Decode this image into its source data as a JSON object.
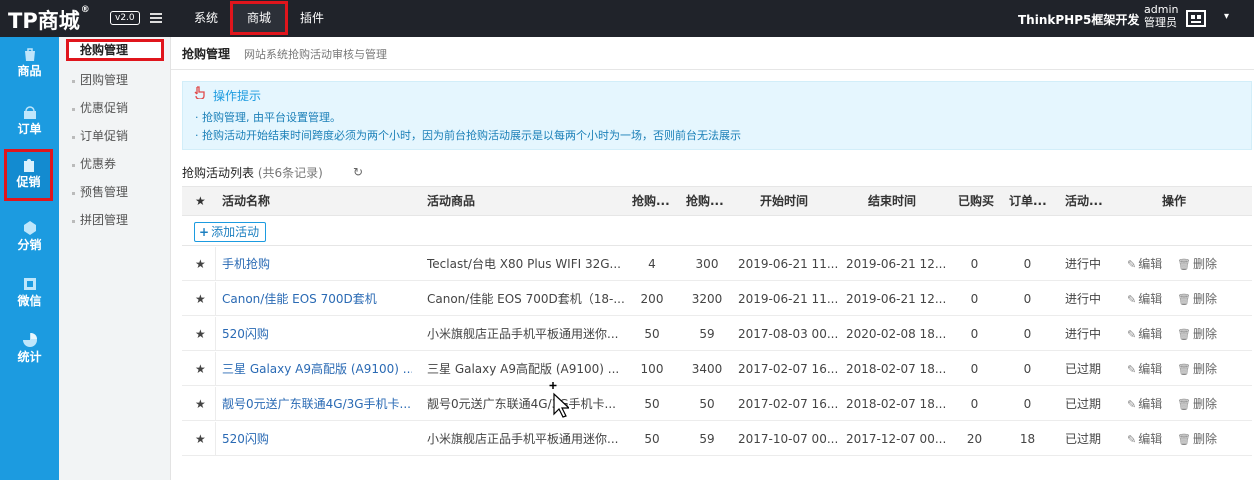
{
  "topbar": {
    "logo": "TP商城",
    "logo_mark": "®",
    "version": "v2.0",
    "tabs": [
      {
        "label": "系统"
      },
      {
        "label": "商城"
      },
      {
        "label": "插件"
      }
    ],
    "brand": "ThinkPHP5框架开发",
    "user_name": "admin",
    "user_role": "管理员"
  },
  "rail": {
    "items": [
      {
        "label": "商品",
        "icon": "goods-icon"
      },
      {
        "label": "订单",
        "icon": "order-icon"
      },
      {
        "label": "促销",
        "icon": "promotion-icon"
      },
      {
        "label": "分销",
        "icon": "distribution-icon"
      },
      {
        "label": "微信",
        "icon": "wechat-icon"
      },
      {
        "label": "统计",
        "icon": "stats-icon"
      }
    ]
  },
  "submenu": {
    "items": [
      {
        "label": "抢购管理"
      },
      {
        "label": "团购管理"
      },
      {
        "label": "优惠促销"
      },
      {
        "label": "订单促销"
      },
      {
        "label": "优惠券"
      },
      {
        "label": "预售管理"
      },
      {
        "label": "拼团管理"
      }
    ]
  },
  "page": {
    "title": "抢购管理",
    "subtitle": "网站系统抢购活动审核与管理"
  },
  "tips": {
    "title": "操作提示",
    "lines": [
      "· 抢购管理, 由平台设置管理。",
      "· 抢购活动开始结束时间跨度必须为两个小时，因为前台抢购活动展示是以每两个小时为一场，否则前台无法展示"
    ]
  },
  "list": {
    "title": "抢购活动列表",
    "count": "(共6条记录)",
    "add_label": "添加活动",
    "columns": [
      "活动名称",
      "活动商品",
      "抢购...",
      "抢购...",
      "开始时间",
      "结束时间",
      "已购买",
      "订单...",
      "活动...",
      "操作"
    ],
    "edit_label": "编辑",
    "delete_label": "删除",
    "rows": [
      {
        "name": "手机抢购",
        "goods": "Teclast/台电 X80 Plus WIFI 32G...",
        "a": "4",
        "b": "300",
        "start": "2019-06-21 11...",
        "end": "2019-06-21 12...",
        "bought": "0",
        "orders": "0",
        "status": "进行中"
      },
      {
        "name": "Canon/佳能 EOS 700D套机",
        "goods": "Canon/佳能 EOS 700D套机（18-...",
        "a": "200",
        "b": "3200",
        "start": "2019-06-21 11...",
        "end": "2019-06-21 12...",
        "bought": "0",
        "orders": "0",
        "status": "进行中"
      },
      {
        "name": "520闪购",
        "goods": "小米旗舰店正品手机平板通用迷你...",
        "a": "50",
        "b": "59",
        "start": "2017-08-03 00...",
        "end": "2020-02-08 18...",
        "bought": "0",
        "orders": "0",
        "status": "进行中"
      },
      {
        "name": "三星 Galaxy A9高配版 (A9100) ...",
        "goods": "三星 Galaxy A9高配版 (A9100) ...",
        "a": "100",
        "b": "3400",
        "start": "2017-02-07 16...",
        "end": "2018-02-07 18...",
        "bought": "0",
        "orders": "0",
        "status": "已过期"
      },
      {
        "name": "靓号0元送广东联通4G/3G手机卡...",
        "goods": "靓号0元送广东联通4G/3G手机卡...",
        "a": "50",
        "b": "50",
        "start": "2017-02-07 16...",
        "end": "2018-02-07 18...",
        "bought": "0",
        "orders": "0",
        "status": "已过期"
      },
      {
        "name": "520闪购",
        "goods": "小米旗舰店正品手机平板通用迷你...",
        "a": "50",
        "b": "59",
        "start": "2017-10-07 00...",
        "end": "2017-12-07 00...",
        "bought": "20",
        "orders": "18",
        "status": "已过期"
      }
    ]
  },
  "colors": {
    "accent": "#1c9be0",
    "highlight": "#e0151c",
    "topbar": "#20232a"
  }
}
